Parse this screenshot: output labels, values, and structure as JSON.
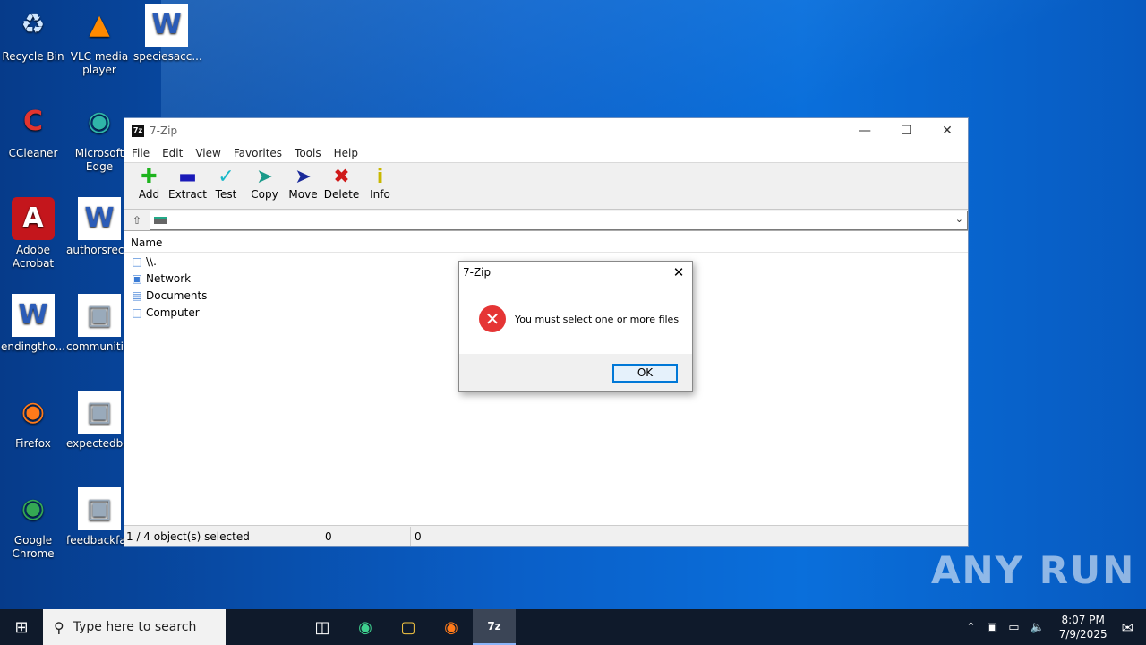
{
  "desktop": {
    "icons": [
      {
        "label": "Recycle Bin",
        "icon": "recycle-bin-icon"
      },
      {
        "label": "VLC media player",
        "icon": "vlc-icon"
      },
      {
        "label": "speciesacc...",
        "icon": "word-doc-icon"
      },
      {
        "label": "CCleaner",
        "icon": "ccleaner-icon"
      },
      {
        "label": "Microsoft Edge",
        "icon": "edge-icon"
      },
      {
        "label": "Adobe Acrobat",
        "icon": "acrobat-icon"
      },
      {
        "label": "authorsrec...",
        "icon": "word-doc-icon"
      },
      {
        "label": "endingtho...",
        "icon": "word-doc-icon"
      },
      {
        "label": "communiti...",
        "icon": "image-file-icon"
      },
      {
        "label": "Firefox",
        "icon": "firefox-icon"
      },
      {
        "label": "expectedbo...",
        "icon": "image-file-icon"
      },
      {
        "label": "Google Chrome",
        "icon": "chrome-icon"
      },
      {
        "label": "feedbackfa...",
        "icon": "image-file-icon"
      }
    ]
  },
  "window": {
    "title": "7-Zip",
    "menu": [
      "File",
      "Edit",
      "View",
      "Favorites",
      "Tools",
      "Help"
    ],
    "toolbar": [
      {
        "label": "Add",
        "icon": "plus-icon",
        "color": "#1db31d"
      },
      {
        "label": "Extract",
        "icon": "minus-icon",
        "color": "#1a1ab8"
      },
      {
        "label": "Test",
        "icon": "check-icon",
        "color": "#19b8c8"
      },
      {
        "label": "Copy",
        "icon": "copy-arrow-icon",
        "color": "#1a9a8a"
      },
      {
        "label": "Move",
        "icon": "move-arrow-icon",
        "color": "#1a2a9a"
      },
      {
        "label": "Delete",
        "icon": "delete-x-icon",
        "color": "#d01a1a"
      },
      {
        "label": "Info",
        "icon": "info-icon",
        "color": "#c8b800"
      }
    ],
    "address": "",
    "column_name": "Name",
    "items": [
      {
        "name": "\\\\.",
        "icon": "computer-icon"
      },
      {
        "name": "Network",
        "icon": "network-icon"
      },
      {
        "name": "Documents",
        "icon": "documents-icon"
      },
      {
        "name": "Computer",
        "icon": "computer-icon"
      }
    ],
    "status": {
      "selected": "1 / 4 object(s) selected",
      "size": "0",
      "packed": "0"
    }
  },
  "dialog": {
    "title": "7-Zip",
    "message": "You must select one or more files",
    "ok_label": "OK"
  },
  "taskbar": {
    "search_placeholder": "Type here to search",
    "time": "8:07 PM",
    "date": "7/9/2025"
  },
  "watermark": "ANY RUN"
}
